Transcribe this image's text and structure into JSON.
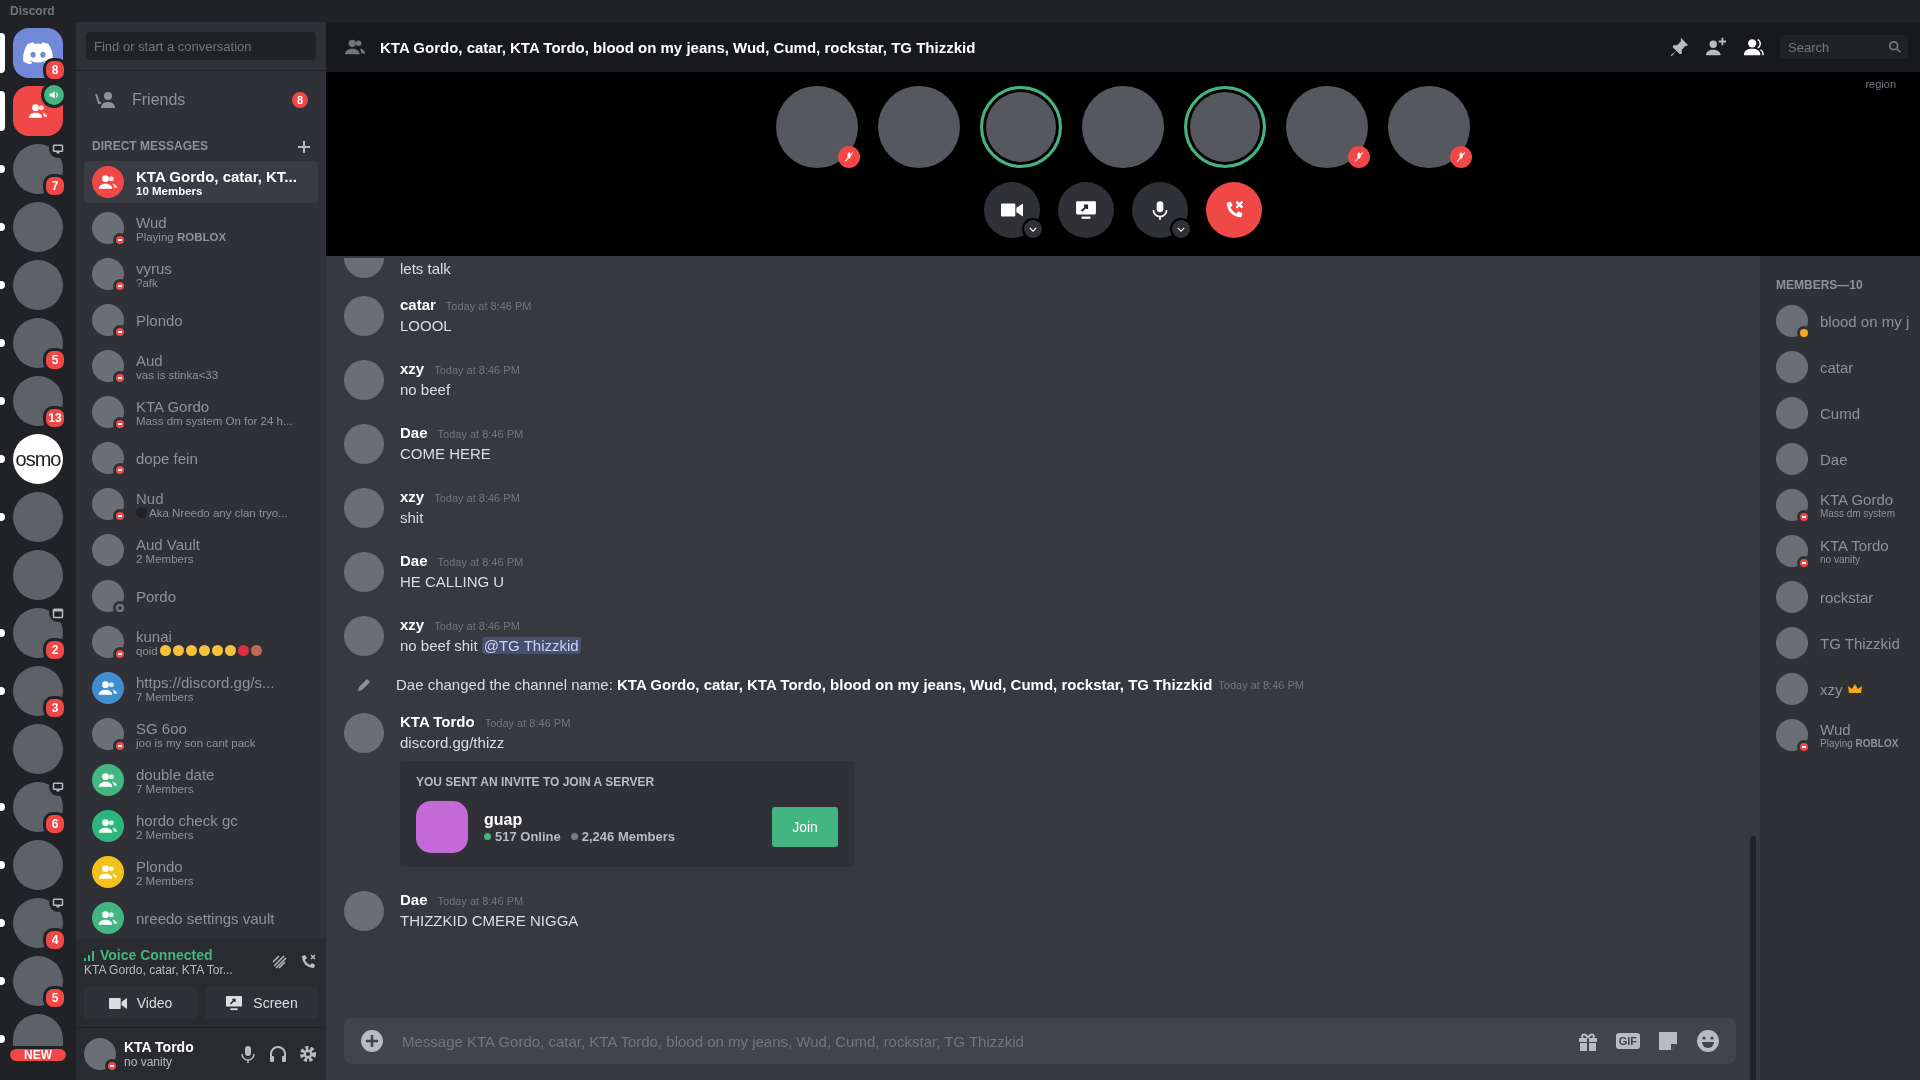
{
  "window": {
    "title": "Discord"
  },
  "servers": [
    {
      "kind": "home",
      "selected": true,
      "unread": false,
      "badge": "8"
    },
    {
      "kind": "call",
      "selected": true,
      "unread": false,
      "voice": true
    },
    {
      "kind": "avatar",
      "selected": false,
      "unread": true,
      "badge": "7",
      "streaming": true
    },
    {
      "kind": "avatar",
      "selected": false,
      "unread": true
    },
    {
      "kind": "avatar",
      "selected": false,
      "unread": true
    },
    {
      "kind": "avatar",
      "selected": false,
      "unread": true,
      "badge": "5"
    },
    {
      "kind": "avatar",
      "selected": false,
      "unread": true,
      "badge": "13"
    },
    {
      "kind": "text",
      "selected": false,
      "unread": true,
      "label": "osmo"
    },
    {
      "kind": "avatar",
      "selected": false,
      "unread": true
    },
    {
      "kind": "avatar",
      "selected": false,
      "unread": false
    },
    {
      "kind": "avatar",
      "selected": false,
      "unread": true,
      "badge": "2",
      "event": true
    },
    {
      "kind": "avatar",
      "selected": false,
      "unread": true,
      "badge": "3"
    },
    {
      "kind": "avatar",
      "selected": false,
      "unread": false
    },
    {
      "kind": "avatar",
      "selected": false,
      "unread": true,
      "badge": "6",
      "streaming": true
    },
    {
      "kind": "avatar",
      "selected": false,
      "unread": true
    },
    {
      "kind": "avatar",
      "selected": false,
      "unread": true,
      "badge": "4",
      "streaming": true
    },
    {
      "kind": "avatar",
      "selected": false,
      "unread": true,
      "badge": "5"
    },
    {
      "kind": "avatar",
      "selected": false,
      "unread": true,
      "new_label": "NEW"
    }
  ],
  "dms": {
    "search": {
      "placeholder": "Find or start a conversation"
    },
    "friends": {
      "label": "Friends",
      "badge": "8"
    },
    "section": "DIRECT MESSAGES",
    "items": [
      {
        "kind": "group",
        "name": "KTA Gordo, catar, KT...",
        "sub": "10 Members",
        "color": "#f04747",
        "selected": true
      },
      {
        "kind": "user",
        "name": "Wud",
        "sub": "Playing **ROBLOX**",
        "dnd": true,
        "selected": false
      },
      {
        "kind": "user",
        "name": "vyrus",
        "sub": "?afk",
        "dnd": true,
        "selected": false
      },
      {
        "kind": "user",
        "name": "Plondo",
        "dnd": true,
        "selected": false
      },
      {
        "kind": "user",
        "name": "Aud",
        "sub": "vas is stinka<33",
        "dnd": true,
        "selected": false
      },
      {
        "kind": "user",
        "name": "KTA Gordo",
        "sub": "Mass dm system On for 24 h...",
        "dnd": true,
        "selected": false
      },
      {
        "kind": "user",
        "name": "dope fein",
        "dnd": true,
        "selected": false
      },
      {
        "kind": "user",
        "name": "Nud",
        "sub": "Aka Nreedo any clan tryo...",
        "sub_emoji": true,
        "dnd": true,
        "selected": false
      },
      {
        "kind": "user",
        "name": "Aud Vault",
        "sub": "2 Members",
        "selected": false
      },
      {
        "kind": "user",
        "name": "Pordo",
        "offline": true,
        "selected": false
      },
      {
        "kind": "user",
        "name": "kunai",
        "sub": "qoid",
        "emojis": [
          {
            "kind": "face"
          },
          {
            "kind": "face"
          },
          {
            "kind": "face"
          },
          {
            "kind": "face"
          },
          {
            "kind": "face"
          },
          {
            "kind": "face"
          },
          {
            "kind": "heart"
          },
          {
            "kind": "rose"
          }
        ],
        "dnd": true,
        "selected": false
      },
      {
        "kind": "group",
        "name": "https://discord.gg/s...",
        "sub": "7 Members",
        "color": "#3e8ed0",
        "selected": false
      },
      {
        "kind": "user",
        "name": "SG 6oo",
        "sub": "joo is my son cant pack",
        "dnd": true,
        "selected": false
      },
      {
        "kind": "group",
        "name": "double date",
        "sub": "7 Members",
        "color": "#43b581",
        "selected": false
      },
      {
        "kind": "group",
        "name": "hordo check gc",
        "sub": "2 Members",
        "color": "#2cb67d",
        "selected": false
      },
      {
        "kind": "group",
        "name": "Plondo",
        "sub": "2 Members",
        "color": "#f0c21a",
        "selected": false
      },
      {
        "kind": "group",
        "name": "nreedo settings vault",
        "color": "#43b581",
        "selected": false
      }
    ]
  },
  "voice": {
    "status": "Voice Connected",
    "channel": "KTA Gordo, catar, KTA Tor...",
    "video": "Video",
    "screen": "Screen"
  },
  "user": {
    "name": "KTA Tordo",
    "sub": "no vanity",
    "dnd": true
  },
  "header": {
    "title": "KTA Gordo, catar, KTA Tordo, blood on my jeans, Wud, Cumd, rockstar, TG Thizzkid",
    "search": {
      "placeholder": "Search"
    },
    "region": "region"
  },
  "call": {
    "participants": [
      {
        "speaking": false,
        "muted": true
      },
      {
        "speaking": false,
        "muted": false
      },
      {
        "speaking": true,
        "muted": false
      },
      {
        "speaking": false,
        "muted": false
      },
      {
        "speaking": true,
        "muted": false
      },
      {
        "speaking": false,
        "muted": true
      },
      {
        "speaking": false,
        "muted": true
      }
    ],
    "controls": [
      {
        "kind": "camera",
        "menu": true
      },
      {
        "kind": "screen",
        "menu": false
      },
      {
        "kind": "mic",
        "menu": true
      },
      {
        "kind": "hangup",
        "menu": false
      }
    ]
  },
  "messages": [
    {
      "kind": "continued",
      "text": "lets talk"
    },
    {
      "kind": "message",
      "author": "catar",
      "time": "Today at 8:46 PM",
      "text": "LOOOL"
    },
    {
      "kind": "message",
      "author": "xzy",
      "time": "Today at 8:46 PM",
      "text": "no beef"
    },
    {
      "kind": "message",
      "author": "Dae",
      "time": "Today at 8:46 PM",
      "text": "COME HERE"
    },
    {
      "kind": "message",
      "author": "xzy",
      "time": "Today at 8:46 PM",
      "text": "shit"
    },
    {
      "kind": "message",
      "author": "Dae",
      "time": "Today at 8:46 PM",
      "text": "HE CALLING U"
    },
    {
      "kind": "message",
      "author": "xzy",
      "time": "Today at 8:46 PM",
      "text": "no beef shit",
      "mention": "@TG Thizzkid"
    },
    {
      "kind": "system",
      "text": "Dae changed the channel name: **KTA Gordo, catar, KTA Tordo, blood on my jeans, Wud, Cumd, rockstar, TG Thizzkid**",
      "time": "Today at 8:46 PM"
    },
    {
      "kind": "message",
      "author": "KTA Tordo",
      "time": "Today at 8:46 PM",
      "text": "discord.gg/thizz",
      "invite": {
        "heading": "YOU SENT AN INVITE TO JOIN A SERVER",
        "name": "guap",
        "online": "517 Online",
        "members": "2,246 Members",
        "button": "Join"
      }
    },
    {
      "kind": "message",
      "author": "Dae",
      "time": "Today at 8:46 PM",
      "text": "THIZZKID CMERE NIGGA"
    }
  ],
  "composer": {
    "placeholder": "Message KTA Gordo, catar, KTA Tordo, blood on my jeans, Wud, Cumd, rockstar, TG Thizzkid",
    "gif": "GIF"
  },
  "members": {
    "heading": "MEMBERS—10",
    "items": [
      {
        "name": "blood on my j",
        "idle": true,
        "owner": false
      },
      {
        "name": "catar",
        "owner": false
      },
      {
        "name": "Cumd",
        "owner": false
      },
      {
        "name": "Dae",
        "owner": false
      },
      {
        "name": "KTA Gordo",
        "sub": "Mass dm system",
        "dnd": true,
        "owner": false
      },
      {
        "name": "KTA Tordo",
        "sub": "no vanity",
        "dnd": true,
        "owner": false
      },
      {
        "name": "rockstar",
        "owner": false
      },
      {
        "name": "TG Thizzkid",
        "owner": false
      },
      {
        "name": "xzy",
        "owner": true
      },
      {
        "name": "Wud",
        "sub": "Playing **ROBLOX**",
        "dnd": true,
        "owner": false
      }
    ]
  }
}
